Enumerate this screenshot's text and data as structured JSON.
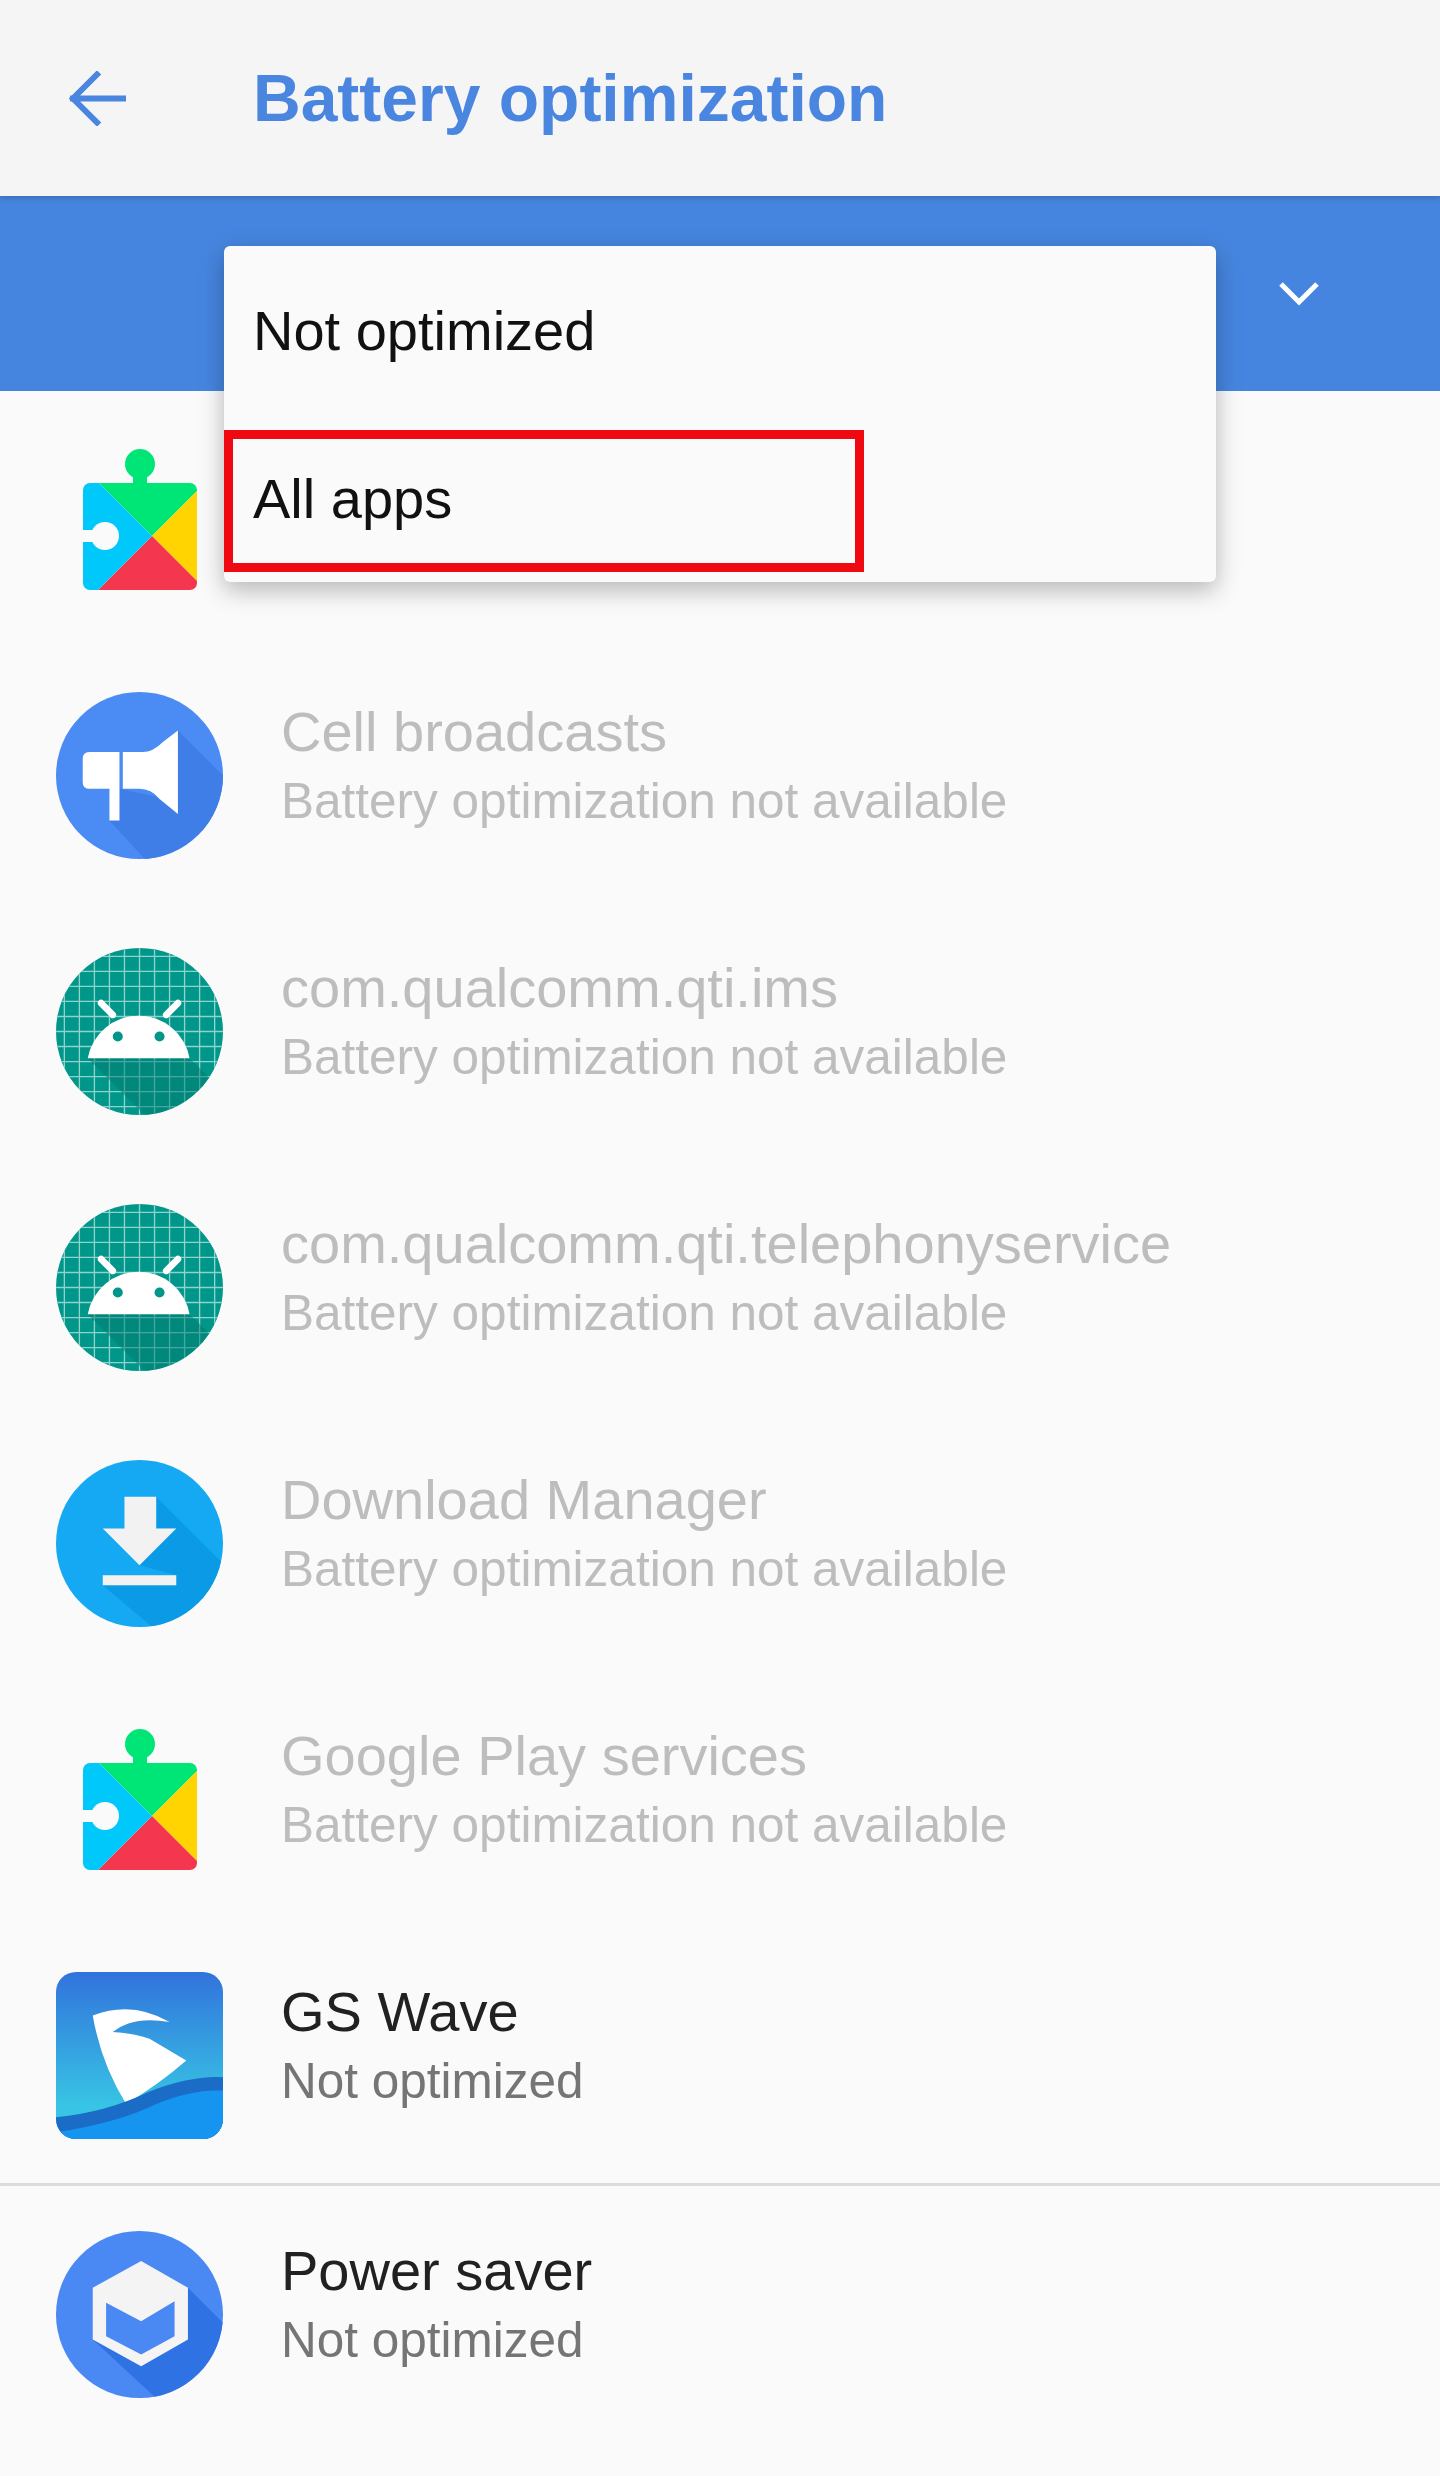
{
  "app_bar": {
    "title": "Battery optimization"
  },
  "menu": {
    "items": [
      {
        "label": "Not optimized",
        "highlighted": false
      },
      {
        "label": "All apps",
        "highlighted": true
      }
    ]
  },
  "list": {
    "groups": [
      {
        "rows": [
          {
            "kind": "puzzle"
          },
          {
            "kind": "megaphone",
            "title": "Cell broadcasts",
            "subtitle": "Battery optimization not available",
            "disabled": true
          },
          {
            "kind": "android",
            "title": "com.qualcomm.qti.ims",
            "subtitle": "Battery optimization not available",
            "disabled": true
          },
          {
            "kind": "android",
            "title": "com.qualcomm.qti.telephonyservice",
            "subtitle": "Battery optimization not available",
            "disabled": true
          },
          {
            "kind": "download",
            "title": "Download Manager",
            "subtitle": "Battery optimization not available",
            "disabled": true
          },
          {
            "kind": "puzzle",
            "title": "Google Play services",
            "subtitle": "Battery optimization not available",
            "disabled": true
          },
          {
            "kind": "sail",
            "title": "GS Wave",
            "subtitle": "Not optimized",
            "disabled": false
          }
        ]
      },
      {
        "rows": [
          {
            "kind": "cube",
            "title": "Power saver",
            "subtitle": "Not optimized",
            "disabled": false
          }
        ]
      }
    ]
  }
}
